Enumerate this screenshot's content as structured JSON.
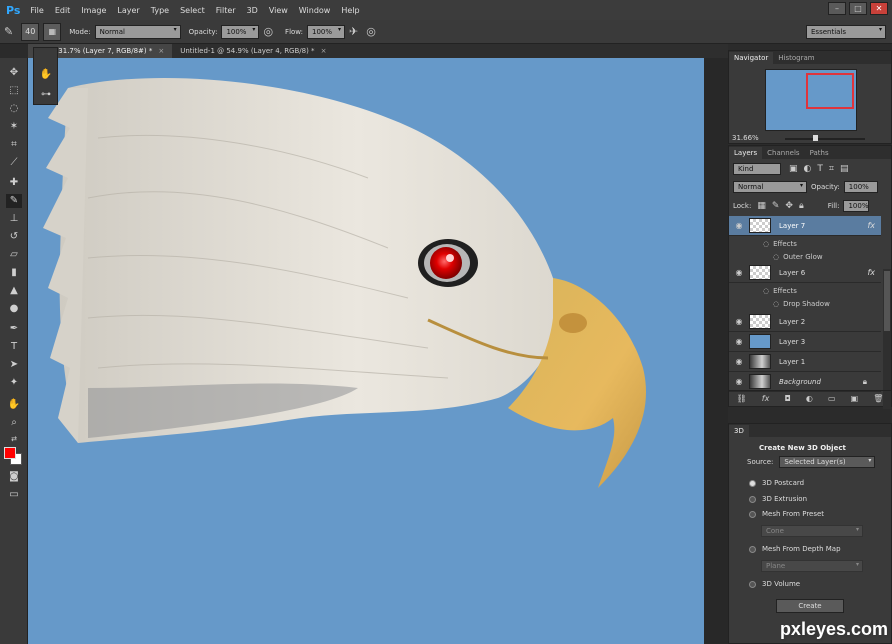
{
  "app": {
    "logo": "Ps"
  },
  "menu": [
    "File",
    "Edit",
    "Image",
    "Layer",
    "Type",
    "Select",
    "Filter",
    "3D",
    "View",
    "Window",
    "Help"
  ],
  "window_buttons": [
    "–",
    "□",
    "✕"
  ],
  "options_bar": {
    "brush_size": "40",
    "mode_label": "Mode:",
    "mode_value": "Normal",
    "opacity_label": "Opacity:",
    "opacity_value": "100%",
    "flow_label": "Flow:",
    "flow_value": "100%",
    "workspace": "Essentials"
  },
  "tabs": [
    {
      "label": "jpg @ 31.7% (Layer 7, RGB/8#) *",
      "active": true
    },
    {
      "label": "Untitled-1 @ 54.9% (Layer 4, RGB/8) *",
      "active": false
    }
  ],
  "tools": [
    "move-icon",
    "marquee-icon",
    "lasso-icon",
    "magic-wand-icon",
    "crop-icon",
    "eyedropper-icon",
    "healing-icon",
    "brush-icon",
    "stamp-icon",
    "history-brush-icon",
    "eraser-icon",
    "gradient-icon",
    "blur-icon",
    "dodge-icon",
    "pen-icon",
    "type-icon",
    "path-select-icon",
    "shape-icon",
    "hand-icon",
    "zoom-icon"
  ],
  "colors": {
    "foreground": "#ff0000",
    "background": "#ffffff",
    "canvas": "#6699c9",
    "accent_selection": "#5a7ca0",
    "nav_box": "#e0343c"
  },
  "navigator": {
    "tabs": [
      "Navigator",
      "Histogram"
    ],
    "zoom": "31.66%"
  },
  "layers_panel": {
    "tabs": [
      "Layers",
      "Channels",
      "Paths"
    ],
    "kind_label": "Kind",
    "blend_mode": "Normal",
    "opacity_label": "Opacity:",
    "opacity_value": "100%",
    "lock_label": "Lock:",
    "fill_label": "Fill:",
    "fill_value": "100%",
    "layers": [
      {
        "name": "Layer 7",
        "thumb": "trans",
        "fx": "fx",
        "active": true
      },
      {
        "name": "Layer 6",
        "thumb": "trans",
        "fx": "fx",
        "active": false
      },
      {
        "name": "Layer 2",
        "thumb": "trans",
        "fx": "",
        "active": false
      },
      {
        "name": "Layer 3",
        "thumb": "blue",
        "fx": "",
        "active": false
      },
      {
        "name": "Layer 1",
        "thumb": "photo",
        "fx": "",
        "active": false
      },
      {
        "name": "Background",
        "thumb": "photo",
        "fx": "",
        "active": false
      }
    ],
    "effects_label": "Effects",
    "effect_7": "Outer Glow",
    "effect_6": "Drop Shadow"
  },
  "panel_3d": {
    "tab": "3D",
    "title": "Create New 3D Object",
    "source_label": "Source:",
    "source_value": "Selected Layer(s)",
    "options": [
      "3D Postcard",
      "3D Extrusion",
      "Mesh From Preset",
      "Mesh From Depth Map",
      "3D Volume"
    ],
    "preset_value": "Cone",
    "depth_value": "Plane",
    "create_label": "Create"
  },
  "watermark": "pxleyes.com"
}
